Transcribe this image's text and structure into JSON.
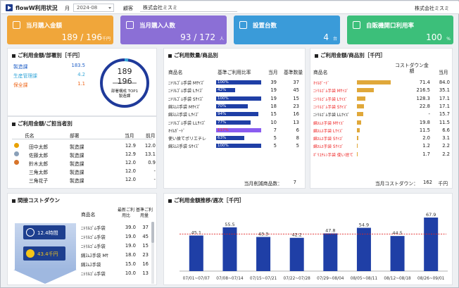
{
  "header": {
    "title": "flowW利用状況",
    "month_label": "月",
    "month_value": "2024-08",
    "customer_label": "顧客",
    "customer_value": "株式会社ミスミ",
    "company": "株式会社ミスミ"
  },
  "kpis": [
    {
      "title": "当月購入金額",
      "value": "189 / 196",
      "unit": "千円",
      "color": "#f0a63a",
      "icon": "yen-icon"
    },
    {
      "title": "当月購入人数",
      "value": "93 / 172",
      "unit": "人",
      "color": "#8b6fd6",
      "icon": "person-icon"
    },
    {
      "title": "設置台数",
      "value": "4",
      "unit": "台",
      "color": "#3a9bd9",
      "icon": "building-icon"
    },
    {
      "title": "自販機開口利用率",
      "value": "100",
      "unit": "%",
      "color": "#3cbf7a",
      "icon": "pie-chart-icon"
    }
  ],
  "dept": {
    "title": "ご利用金額/部署別［千円］",
    "rows": [
      {
        "name": "製造課",
        "value": "183.5",
        "color": "#1f5fc7"
      },
      {
        "name": "生産管理課",
        "value": "4.2",
        "color": "#37a7d9"
      },
      {
        "name": "保全課",
        "value": "1.1",
        "color": "#ef6a1f"
      }
    ],
    "donut_top": "189",
    "donut_bottom": "196",
    "donut_cap1": "部署構成 TOP1",
    "donut_cap2": "製造課"
  },
  "staff": {
    "title": "ご利用金額/ご担当者別",
    "headers": [
      "氏名",
      "部署",
      "当月",
      "前月"
    ],
    "rows": [
      {
        "name": "田中太郎",
        "dept": "製造課",
        "cur": "12.9",
        "prev": "12.0",
        "rank": "1"
      },
      {
        "name": "佐藤太郎",
        "dept": "製造課",
        "cur": "12.9",
        "prev": "13.1",
        "rank": "2"
      },
      {
        "name": "鈴木太郎",
        "dept": "製造課",
        "cur": "12.0",
        "prev": "0.9",
        "rank": "3"
      },
      {
        "name": "三角太郎",
        "dept": "製造課",
        "cur": "12.0",
        "prev": "-",
        "rank": ""
      },
      {
        "name": "三角花子",
        "dept": "製造課",
        "cur": "12.0",
        "prev": "-",
        "rank": ""
      }
    ]
  },
  "qty": {
    "title": "ご利用数量/商品別",
    "headers": [
      "商品名",
      "基準ご利用比率",
      "当月",
      "基準数量"
    ],
    "rows": [
      {
        "name": "ﾆﾄﾘﾙｺﾞﾑ手袋 Mｻｲｽﾞ",
        "pct": "100%",
        "ratio": 1.0,
        "cur": "39",
        "base": "37",
        "red": false
      },
      {
        "name": "ﾆﾄﾘﾙｺﾞﾑ手袋 Lｻｲｽﾞ",
        "pct": "42%",
        "ratio": 0.42,
        "cur": "19",
        "base": "45",
        "red": false
      },
      {
        "name": "ﾆﾄﾘﾙｺﾞﾑ手袋 Sｻｲｽﾞ",
        "pct": "100%",
        "ratio": 1.0,
        "cur": "19",
        "base": "15",
        "red": false
      },
      {
        "name": "綿ｽﾑｽ手袋 Mｻｲｽﾞ",
        "pct": "70%",
        "ratio": 0.7,
        "cur": "18",
        "base": "23",
        "red": false
      },
      {
        "name": "綿ｽﾑｽ手袋 Lｻｲｽﾞ",
        "pct": "94%",
        "ratio": 0.94,
        "cur": "15",
        "base": "16",
        "red": false
      },
      {
        "name": "ﾆﾄﾘﾙｺﾞﾑ手袋 LLｻｲｽﾞ",
        "pct": "77%",
        "ratio": 0.77,
        "cur": "10",
        "base": "13",
        "red": false
      },
      {
        "name": "ｵｲﾙｶﾞｰﾄﾞ",
        "pct": "117%",
        "ratio": 1.0,
        "cur": "7",
        "base": "6",
        "red": true
      },
      {
        "name": "使い捨てポリエチレ",
        "pct": "63%",
        "ratio": 0.63,
        "cur": "5",
        "base": "8",
        "red": false
      },
      {
        "name": "綿ｽﾑｽ手袋 Sｻｲｽﾞ",
        "pct": "100%",
        "ratio": 1.0,
        "cur": "5",
        "base": "5",
        "red": false
      }
    ],
    "footer_label": "当月削減商品数：",
    "footer_value": "7"
  },
  "amount": {
    "title": "ご利用金額/商品別［千円］",
    "headers": [
      "商品名",
      "コストダウン金額",
      "当月"
    ],
    "rows": [
      {
        "name": "ｵｲﾙｶﾞｰﾄﾞ",
        "cd": "71.4",
        "cur": "84.0",
        "ratio": 1.0,
        "red": true
      },
      {
        "name": "ﾆﾄﾘﾙｺﾞﾑ手袋 Mｻｲｽﾞ",
        "cd": "216.5",
        "cur": "35.1",
        "ratio": 0.5,
        "red": true
      },
      {
        "name": "ﾆﾄﾘﾙｺﾞﾑ手袋 Lｻｲｽﾞ",
        "cd": "128.3",
        "cur": "17.1",
        "ratio": 0.24,
        "red": true
      },
      {
        "name": "ﾆﾄﾘﾙｺﾞﾑ手袋 Sｻｲｽﾞ",
        "cd": "22.8",
        "cur": "17.1",
        "ratio": 0.2,
        "red": true
      },
      {
        "name": "ﾆﾄﾘﾙｺﾞﾑ手袋 LLｻｲｽﾞ",
        "cd": "-",
        "cur": "15.7",
        "ratio": 0.18,
        "red": false
      },
      {
        "name": "綿ｽﾑｽ手袋 Mｻｲｽﾞ",
        "cd": "19.8",
        "cur": "11.5",
        "ratio": 0.13,
        "red": true
      },
      {
        "name": "綿ｽﾑｽ手袋 Lｻｲｽﾞ",
        "cd": "11.5",
        "cur": "6.6",
        "ratio": 0.08,
        "red": true
      },
      {
        "name": "綿ｽﾑｽ手袋 Sｻｲｽﾞ",
        "cd": "2.0",
        "cur": "3.1",
        "ratio": 0.04,
        "red": true
      },
      {
        "name": "綿ｽﾑｽ手袋 Sｻｲｽﾞ",
        "cd": "1.2",
        "cur": "2.2",
        "ratio": 0.03,
        "red": true
      },
      {
        "name": "ﾎﾟﾘｴﾁﾚﾝ手袋 使い捨て",
        "cd": "1.7",
        "cur": "2.2",
        "ratio": 0.03,
        "red": true
      }
    ],
    "footer_label": "当月コストダウン：",
    "footer_value": "162",
    "footer_unit": "千円"
  },
  "indirect": {
    "title": "間接コストダウン",
    "time_value": "12.4時間",
    "money_value": "43.4千円",
    "headers": [
      "商品名",
      "最新ご利用比",
      "基準ご利用量"
    ],
    "rows": [
      {
        "name": "ﾆﾄﾘﾙｺﾞﾑ手袋",
        "a": "39.0",
        "b": "37"
      },
      {
        "name": "ﾆﾄﾘﾙｺﾞﾑ手袋",
        "a": "19.0",
        "b": "45"
      },
      {
        "name": "ﾆﾄﾘﾙｺﾞﾑ手袋",
        "a": "19.0",
        "b": "15"
      },
      {
        "name": "綿ｽﾑｽ手袋 Mｻ",
        "a": "18.0",
        "b": "23"
      },
      {
        "name": "綿ｽﾑｽ手袋",
        "a": "15.0",
        "b": "16"
      },
      {
        "name": "ﾆﾄﾘﾙｺﾞﾑ手袋",
        "a": "10.0",
        "b": "13"
      }
    ]
  },
  "chart_data": {
    "type": "bar",
    "title": "ご利用金額推移/週次［千円］",
    "categories": [
      "07/01~07/07",
      "07/08~07/14",
      "07/15~07/21",
      "07/22~07/28",
      "07/29~08/04",
      "08/05~08/11",
      "08/12~08/18",
      "08/26~09/01"
    ],
    "values": [
      45.1,
      55.5,
      43.3,
      42.2,
      47.8,
      54.9,
      44.5,
      67.9
    ],
    "ylim": [
      0,
      75
    ],
    "reference_line": 47,
    "bar_color": "#1f3fa6",
    "line_color": "#e02020"
  }
}
